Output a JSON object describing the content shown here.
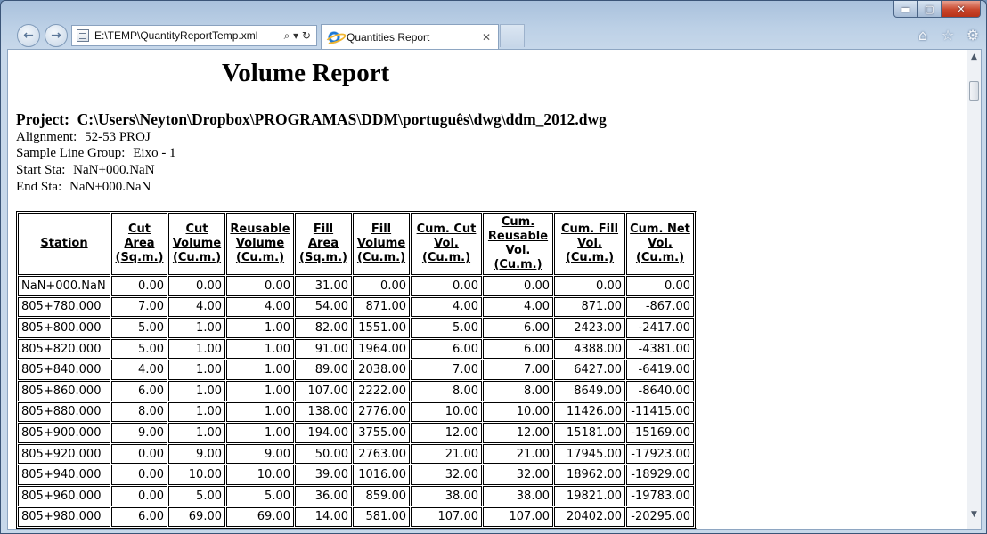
{
  "browser": {
    "address": "E:\\TEMP\\QuantityReportTemp.xml",
    "address_tools": "⌕ ▾ ↻",
    "tab_title": "Quantities Report",
    "tab_close": "✕",
    "caption": {
      "minimize": "▬",
      "maximize": "▢",
      "close": "✕"
    },
    "icons": [
      "home-icon",
      "favorites-star-icon",
      "tools-gear-icon"
    ],
    "accent_color": "#1e78d4"
  },
  "report": {
    "title": "Volume Report",
    "project_label": "Project:",
    "project_value": "C:\\Users\\Neyton\\Dropbox\\PROGRAMAS\\DDM\\português\\dwg\\ddm_2012.dwg",
    "alignment_label": "Alignment:",
    "alignment_value": "52-53 PROJ",
    "sample_line_label": "Sample Line Group:",
    "sample_line_value": "Eixo - 1",
    "start_label": "Start Sta:",
    "start_value": "NaN+000.NaN",
    "end_label": "End Sta:",
    "end_value": "NaN+000.NaN"
  },
  "table": {
    "headers": [
      [
        "Station"
      ],
      [
        "Cut",
        "Area",
        "(Sq.m.)"
      ],
      [
        "Cut",
        "Volume",
        "(Cu.m.)"
      ],
      [
        "Reusable",
        "Volume",
        "(Cu.m.)"
      ],
      [
        "Fill",
        "Area",
        "(Sq.m.)"
      ],
      [
        "Fill",
        "Volume",
        "(Cu.m.)"
      ],
      [
        "Cum. Cut",
        "Vol.",
        "(Cu.m.)"
      ],
      [
        "Cum.",
        "Reusable",
        "Vol.",
        "(Cu.m.)"
      ],
      [
        "Cum. Fill",
        "Vol.",
        "(Cu.m.)"
      ],
      [
        "Cum. Net",
        "Vol.",
        "(Cu.m.)"
      ]
    ],
    "rows": [
      [
        "NaN+000.NaN",
        "0.00",
        "0.00",
        "0.00",
        "31.00",
        "0.00",
        "0.00",
        "0.00",
        "0.00",
        "0.00"
      ],
      [
        "805+780.000",
        "7.00",
        "4.00",
        "4.00",
        "54.00",
        "871.00",
        "4.00",
        "4.00",
        "871.00",
        "-867.00"
      ],
      [
        "805+800.000",
        "5.00",
        "1.00",
        "1.00",
        "82.00",
        "1551.00",
        "5.00",
        "6.00",
        "2423.00",
        "-2417.00"
      ],
      [
        "805+820.000",
        "5.00",
        "1.00",
        "1.00",
        "91.00",
        "1964.00",
        "6.00",
        "6.00",
        "4388.00",
        "-4381.00"
      ],
      [
        "805+840.000",
        "4.00",
        "1.00",
        "1.00",
        "89.00",
        "2038.00",
        "7.00",
        "7.00",
        "6427.00",
        "-6419.00"
      ],
      [
        "805+860.000",
        "6.00",
        "1.00",
        "1.00",
        "107.00",
        "2222.00",
        "8.00",
        "8.00",
        "8649.00",
        "-8640.00"
      ],
      [
        "805+880.000",
        "8.00",
        "1.00",
        "1.00",
        "138.00",
        "2776.00",
        "10.00",
        "10.00",
        "11426.00",
        "-11415.00"
      ],
      [
        "805+900.000",
        "9.00",
        "1.00",
        "1.00",
        "194.00",
        "3755.00",
        "12.00",
        "12.00",
        "15181.00",
        "-15169.00"
      ],
      [
        "805+920.000",
        "0.00",
        "9.00",
        "9.00",
        "50.00",
        "2763.00",
        "21.00",
        "21.00",
        "17945.00",
        "-17923.00"
      ],
      [
        "805+940.000",
        "0.00",
        "10.00",
        "10.00",
        "39.00",
        "1016.00",
        "32.00",
        "32.00",
        "18962.00",
        "-18929.00"
      ],
      [
        "805+960.000",
        "0.00",
        "5.00",
        "5.00",
        "36.00",
        "859.00",
        "38.00",
        "38.00",
        "19821.00",
        "-19783.00"
      ],
      [
        "805+980.000",
        "6.00",
        "69.00",
        "69.00",
        "14.00",
        "581.00",
        "107.00",
        "107.00",
        "20402.00",
        "-20295.00"
      ]
    ]
  }
}
